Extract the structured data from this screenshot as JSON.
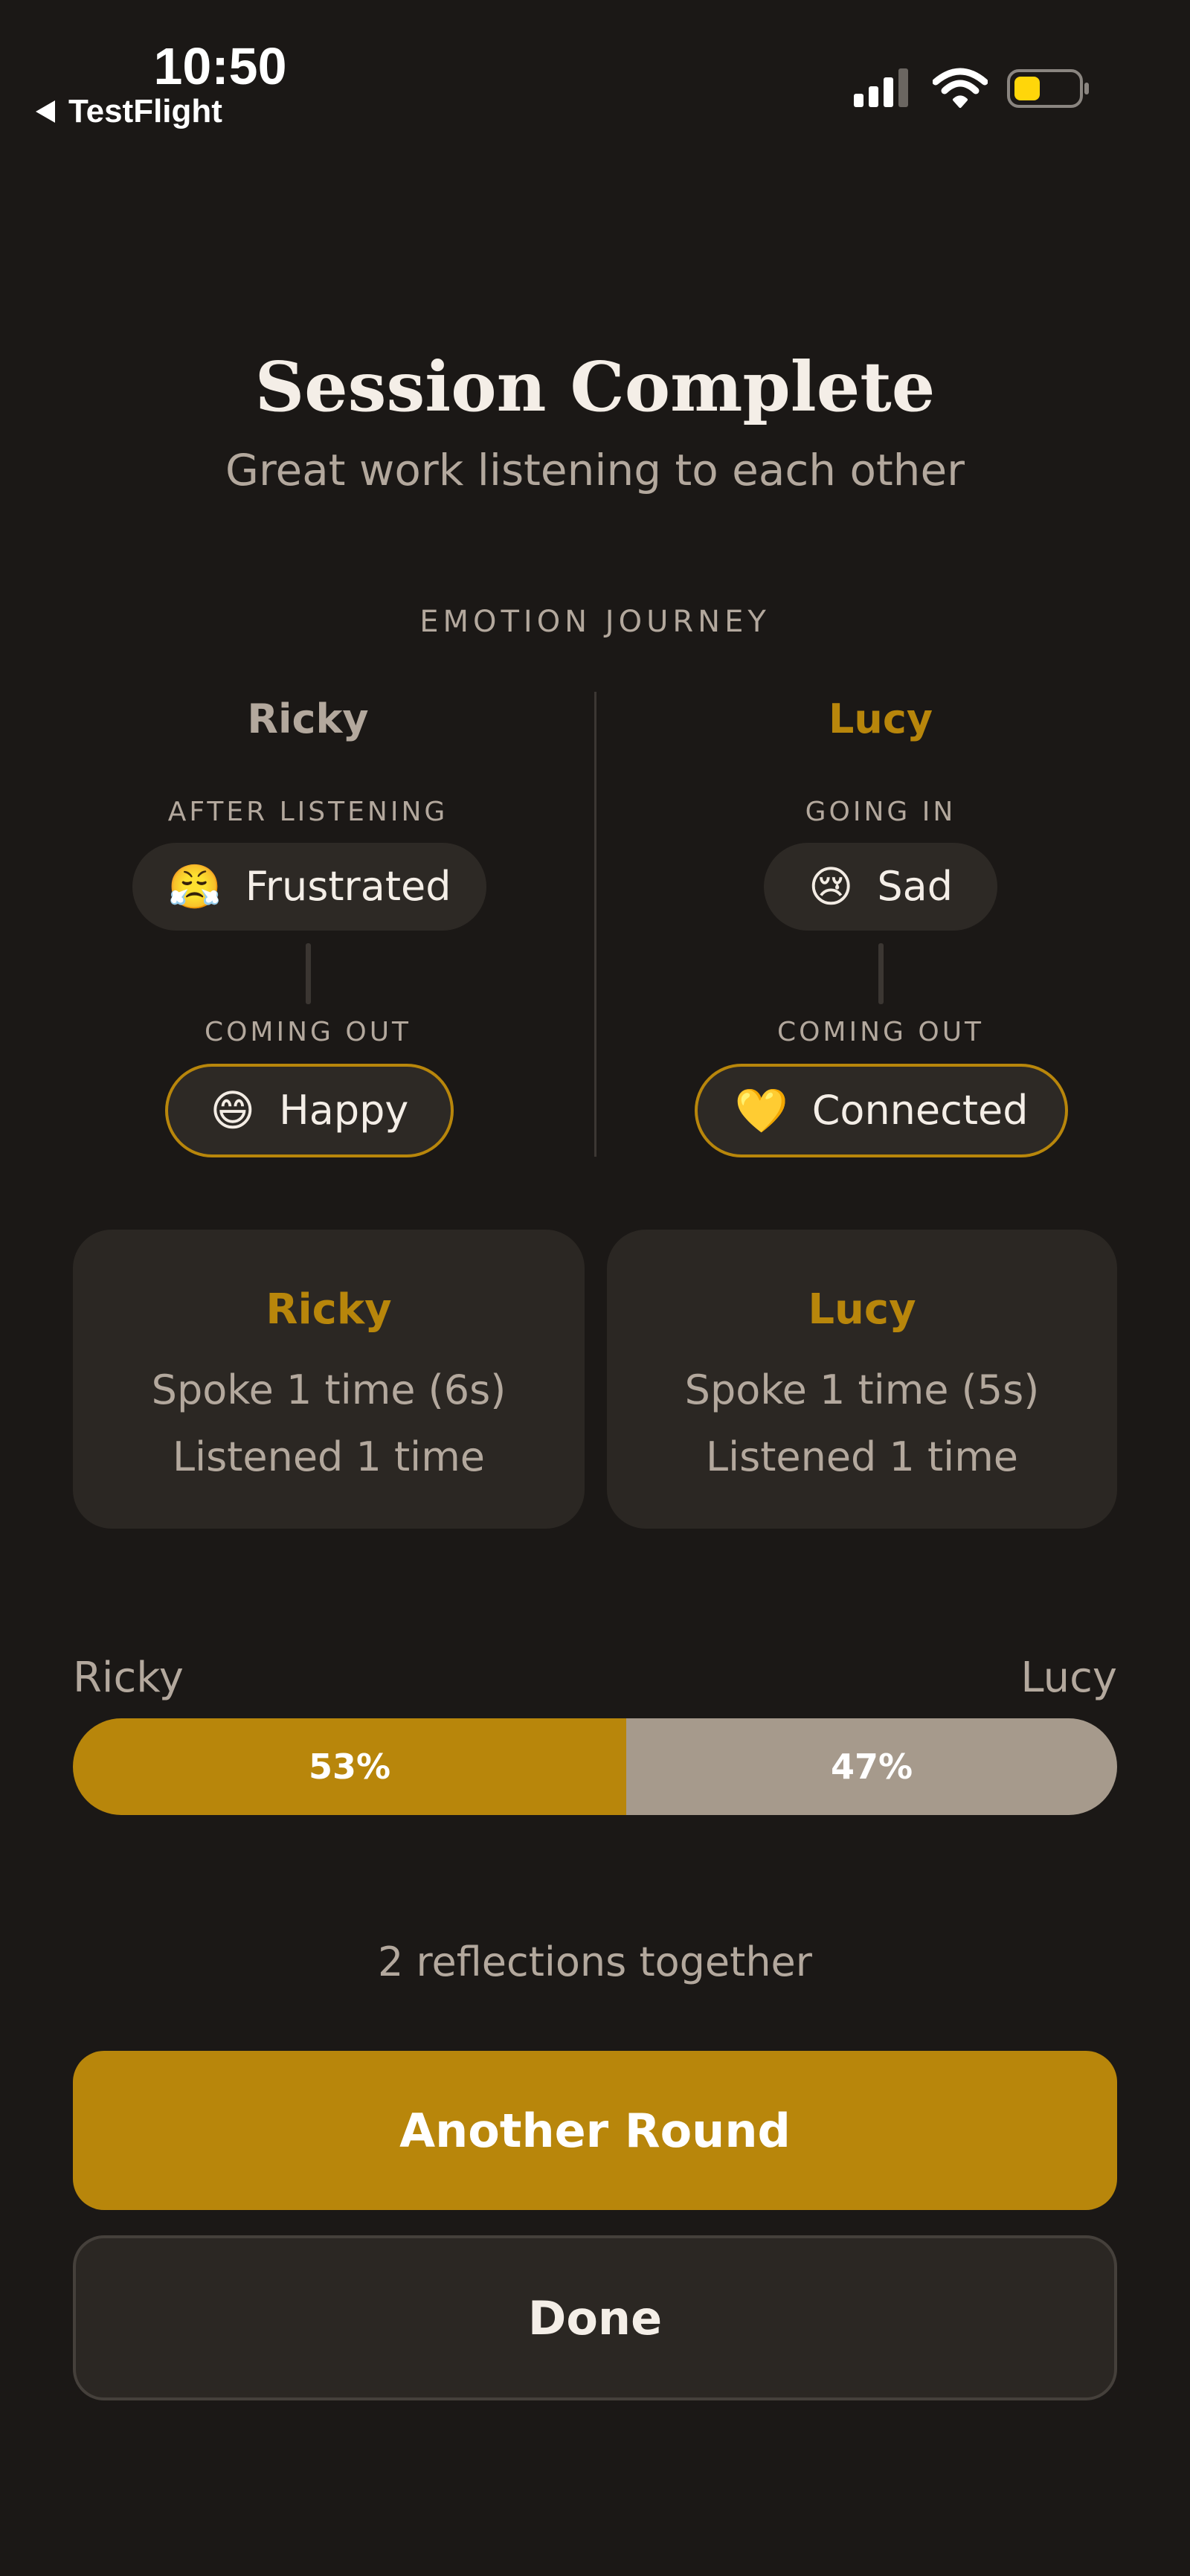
{
  "status_bar": {
    "time": "10:50",
    "back_label": "TestFlight",
    "icons": [
      "back-caret-icon",
      "cellular-signal-icon",
      "wifi-icon",
      "battery-icon"
    ]
  },
  "header": {
    "title": "Session Complete",
    "subtitle": "Great work listening to each other"
  },
  "emotion_journey": {
    "label": "EMOTION JOURNEY",
    "participants": [
      {
        "name": "Ricky",
        "first_stage_label": "AFTER LISTENING",
        "first_emotion": {
          "emoji": "😤",
          "label": "Frustrated",
          "icon": "frustrated-face-icon"
        },
        "second_stage_label": "COMING OUT",
        "second_emotion": {
          "emoji": "😄",
          "label": "Happy",
          "icon": "happy-face-icon"
        }
      },
      {
        "name": "Lucy",
        "first_stage_label": "GOING IN",
        "first_emotion": {
          "emoji": "😢",
          "label": "Sad",
          "icon": "crying-face-icon"
        },
        "second_stage_label": "COMING OUT",
        "second_emotion": {
          "emoji": "💛",
          "label": "Connected",
          "icon": "yellow-heart-icon"
        }
      }
    ]
  },
  "stats": [
    {
      "name": "Ricky",
      "spoke": "Spoke 1 time (6s)",
      "listened": "Listened 1 time"
    },
    {
      "name": "Lucy",
      "spoke": "Spoke 1 time (5s)",
      "listened": "Listened 1 time"
    }
  ],
  "talk_share": {
    "left_name": "Ricky",
    "right_name": "Lucy",
    "left_percent": 53,
    "right_percent": 47,
    "left_label": "53%",
    "right_label": "47%"
  },
  "reflections_text": "2 reflections together",
  "buttons": {
    "primary_label": "Another Round",
    "secondary_label": "Done"
  },
  "colors": {
    "background": "#1b1816",
    "accent": "#b8860b",
    "muted_text": "#b3a89d",
    "card": "#2b2723",
    "share_secondary": "#a69a8c"
  }
}
